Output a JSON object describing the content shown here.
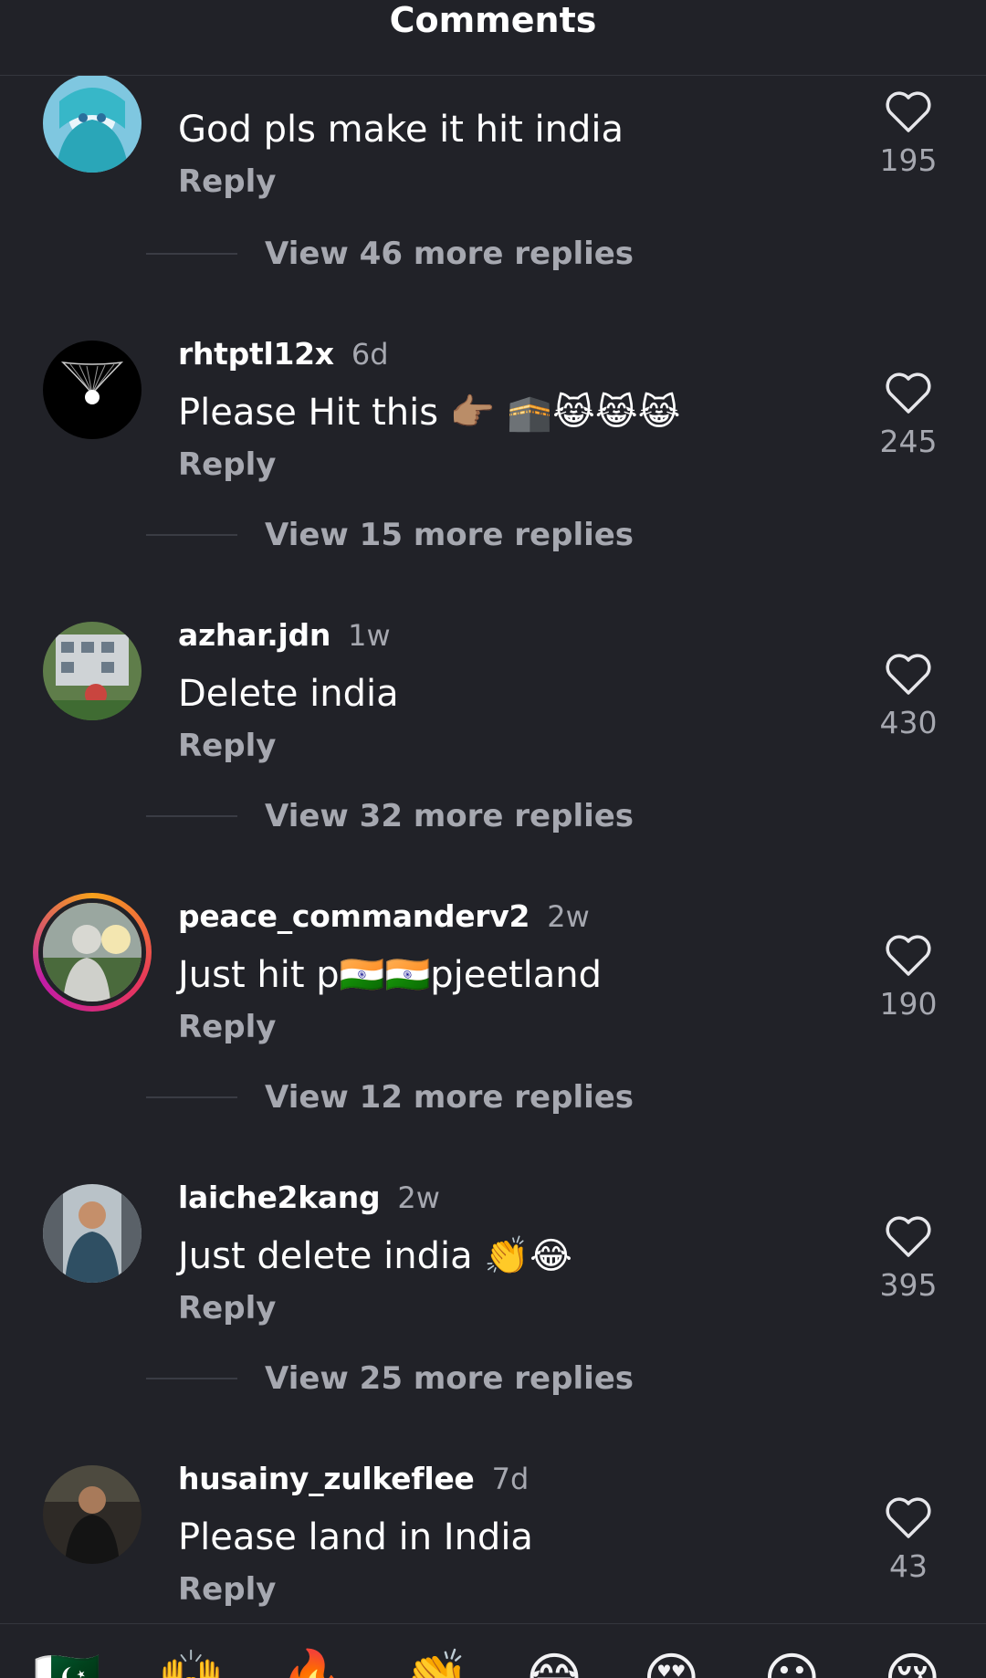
{
  "header": {
    "title": "Comments"
  },
  "comments": [
    {
      "username": "",
      "time": "",
      "text": "God pls make it hit india",
      "reply_label": "Reply",
      "likes": "195",
      "view_more": "View 46 more replies"
    },
    {
      "username": "rhtptl12x",
      "time": "6d",
      "text": "Please Hit this 👉🏽 🕋😹😹😹",
      "reply_label": "Reply",
      "likes": "245",
      "view_more": "View 15 more replies"
    },
    {
      "username": "azhar.jdn",
      "time": "1w",
      "text": "Delete india",
      "reply_label": "Reply",
      "likes": "430",
      "view_more": "View 32 more replies"
    },
    {
      "username": "peace_commanderv2",
      "time": "2w",
      "text": "Just hit p🇮🇳🇮🇳pjeetland",
      "reply_label": "Reply",
      "likes": "190",
      "view_more": "View 12 more replies"
    },
    {
      "username": "laiche2kang",
      "time": "2w",
      "text": "Just delete india 👏😂",
      "reply_label": "Reply",
      "likes": "395",
      "view_more": "View 25 more replies"
    },
    {
      "username": "husainy_zulkeflee",
      "time": "7d",
      "text": "Please land in India",
      "reply_label": "Reply",
      "likes": "43",
      "view_more": ""
    }
  ],
  "quick_emojis": [
    "🇵🇰",
    "🙌",
    "🔥",
    "👏",
    "😂",
    "😍",
    "😮",
    "😢"
  ],
  "colors": {
    "background": "#212228",
    "text_primary": "#ffffff",
    "text_secondary": "#a6a8b0"
  },
  "icons": {
    "like": "heart-outline-icon"
  }
}
